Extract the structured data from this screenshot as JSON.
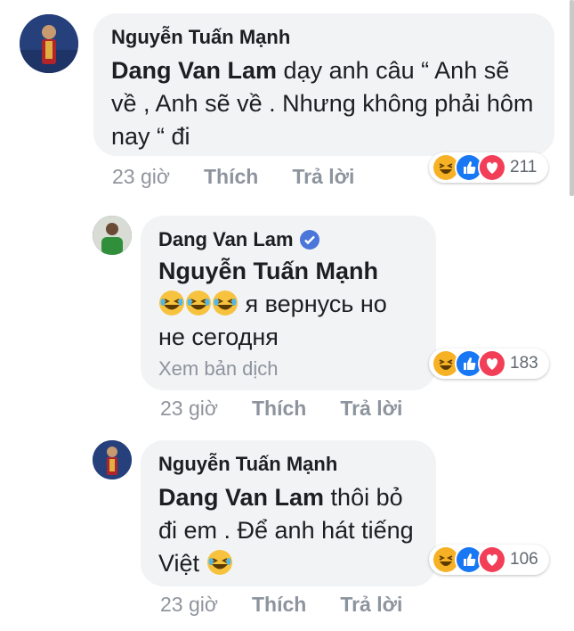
{
  "comments": [
    {
      "author": "Nguyễn Tuấn Mạnh",
      "mention": "Dang Van Lam",
      "text": " dạy anh câu “ Anh sẽ về , Anh sẽ về . Nhưng không phải hôm nay “ đi",
      "time": "23 giờ",
      "like_label": "Thích",
      "reply_label": "Trả lời",
      "reaction_count": "211"
    },
    {
      "author": "Dang Van Lam",
      "verified": true,
      "mention": "Nguyễn Tuấn Mạnh",
      "text": " я вернусь но не сегодня",
      "translate_label": "Xem bản dịch",
      "time": "23 giờ",
      "like_label": "Thích",
      "reply_label": "Trả lời",
      "reaction_count": "183"
    },
    {
      "author": "Nguyễn Tuấn Mạnh",
      "mention": "Dang Van Lam",
      "text": " thôi bỏ đi em . Để anh hát tiếng Việt",
      "time": "23 giờ",
      "like_label": "Thích",
      "reply_label": "Trả lời",
      "reaction_count": "106"
    }
  ],
  "reaction_icons": [
    "haha-icon",
    "like-icon",
    "love-icon"
  ],
  "colors": {
    "bubble": "#f2f3f5",
    "like_blue": "#1877f2",
    "love_red": "#f33e58",
    "haha_yellow": "#f7b125",
    "meta_gray": "#90949c"
  }
}
